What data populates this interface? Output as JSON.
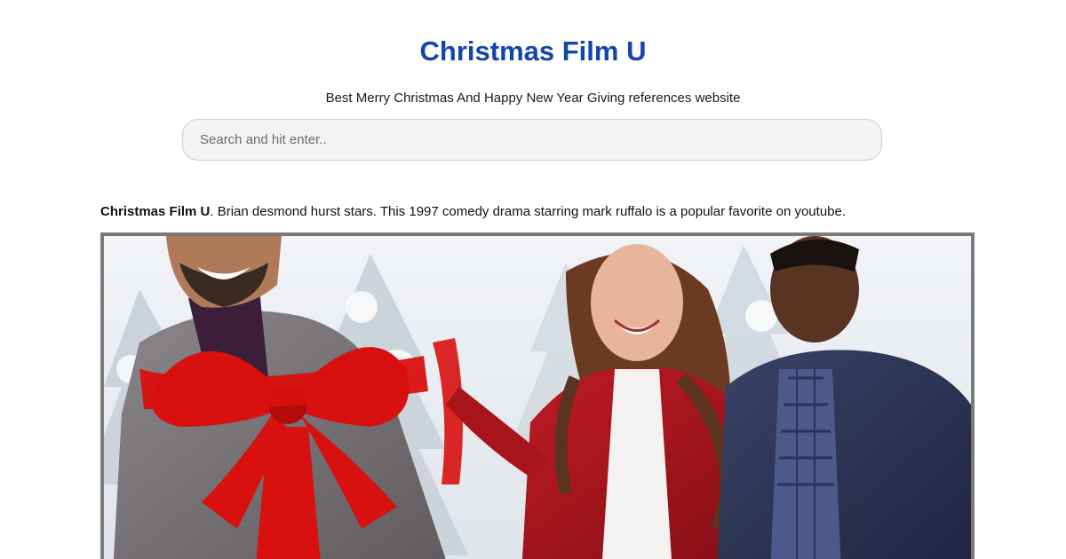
{
  "header": {
    "site_title": "Christmas Film U",
    "tagline": "Best Merry Christmas And Happy New Year Giving references website"
  },
  "search": {
    "placeholder": "Search and hit enter.."
  },
  "article": {
    "intro_bold": "Christmas Film U",
    "intro_text": ". Brian desmond hurst stars. This 1997 comedy drama starring mark ruffalo is a popular favorite on youtube."
  },
  "hero_image": {
    "subject": "three-people-with-red-gift-bow-snowy-trees"
  },
  "colors": {
    "title_blue": "#1346a8",
    "search_bg": "#f3f3f4",
    "search_border": "#c7cde8",
    "frame_border": "#7a7a7a",
    "bow_red": "#d8100f",
    "jacket_red": "#a3121a"
  }
}
